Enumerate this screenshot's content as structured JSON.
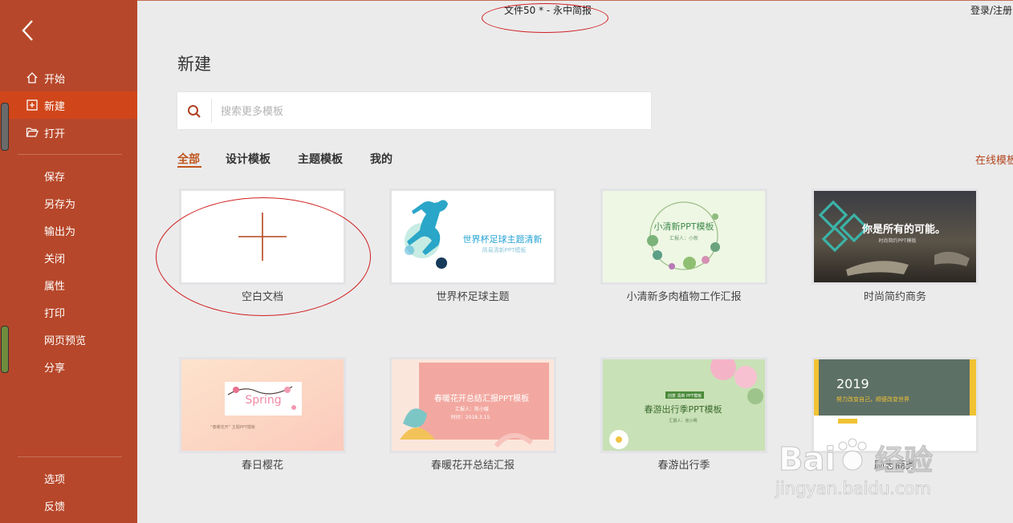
{
  "window": {
    "title": "文件50 * - 永中简报",
    "login": "登录/注册"
  },
  "sidebar": {
    "back_icon": "back-arrow-icon",
    "items": [
      {
        "label": "开始",
        "icon": "home-icon"
      },
      {
        "label": "新建",
        "icon": "new-doc-icon",
        "active": true
      },
      {
        "label": "打开",
        "icon": "folder-open-icon"
      },
      {
        "label": "保存"
      },
      {
        "label": "另存为"
      },
      {
        "label": "输出为"
      },
      {
        "label": "关闭"
      },
      {
        "label": "属性"
      },
      {
        "label": "打印"
      },
      {
        "label": "网页预览"
      },
      {
        "label": "分享"
      }
    ],
    "bottom_items": [
      {
        "label": "选项"
      },
      {
        "label": "反馈"
      }
    ]
  },
  "main": {
    "title": "新建",
    "search": {
      "placeholder": "搜索更多模板"
    },
    "tabs": [
      {
        "label": "全部",
        "active": true
      },
      {
        "label": "设计模板"
      },
      {
        "label": "主题模板"
      },
      {
        "label": "我的"
      }
    ],
    "online_link": "在线模板",
    "templates": [
      {
        "label": "空白文档"
      },
      {
        "label": "世界杯足球主题",
        "thumb_title": "世界杯足球主题清新",
        "thumb_sub": "简易清新PPT模板"
      },
      {
        "label": "小清新多肉植物工作汇报",
        "thumb_title": "小清新PPT模板",
        "thumb_sub": "汇报人：小新"
      },
      {
        "label": "时尚简约商务",
        "thumb_title": "你是所有的可能。",
        "thumb_sub": "时尚简约PPT模板"
      },
      {
        "label": "春日樱花",
        "thumb_title": "Spring",
        "thumb_sub": "“春暖花开” 主题PPT模板"
      },
      {
        "label": "春暖花开总结汇报",
        "thumb_title": "春暖花开总结汇报PPT模板",
        "thumb_sub": "汇报人：陈小暖",
        "thumb_date": "时间：2018.3.15"
      },
      {
        "label": "春游出行季",
        "thumb_title": "春游出行季PPT模板",
        "thumb_sub": "汇报人：张小明",
        "thumb_tag": "创意 清新 PPT模板"
      },
      {
        "label": "励志商务",
        "thumb_title": "2019",
        "thumb_sub": "努力改变自己，顺便改变世界"
      }
    ]
  },
  "watermark": {
    "brand": "Bai",
    "brand_suffix": "经验",
    "url": "jingyan.baidu.com"
  },
  "colors": {
    "sidebar": "#b7472a",
    "active": "#d0461a",
    "accent": "#c0561e",
    "annotation": "#d01e1e"
  }
}
